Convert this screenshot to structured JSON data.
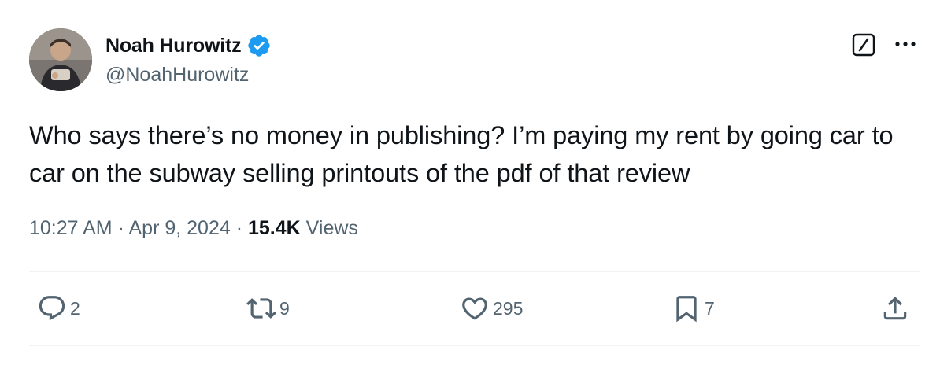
{
  "author": {
    "name": "Noah Hurowitz",
    "handle": "@NoahHurowitz",
    "verified": true
  },
  "tweet": {
    "text": "Who says there’s no money in publishing? I’m paying my rent by going car to car on the subway selling printouts of the pdf of that review"
  },
  "meta": {
    "time": "10:27 AM",
    "separator": "·",
    "date": "Apr 9, 2024",
    "views_count": "15.4K",
    "views_label": "Views"
  },
  "actions": {
    "replies": "2",
    "reposts": "9",
    "likes": "295",
    "bookmarks": "7"
  },
  "colors": {
    "text_primary": "#0f1419",
    "text_secondary": "#536471",
    "verified_blue": "#1d9bf0",
    "divider": "#eff3f4"
  },
  "icons": [
    "avatar-photo",
    "verified-badge-icon",
    "grok-icon",
    "more-icon",
    "reply-icon",
    "repost-icon",
    "like-icon",
    "bookmark-icon",
    "share-icon"
  ]
}
